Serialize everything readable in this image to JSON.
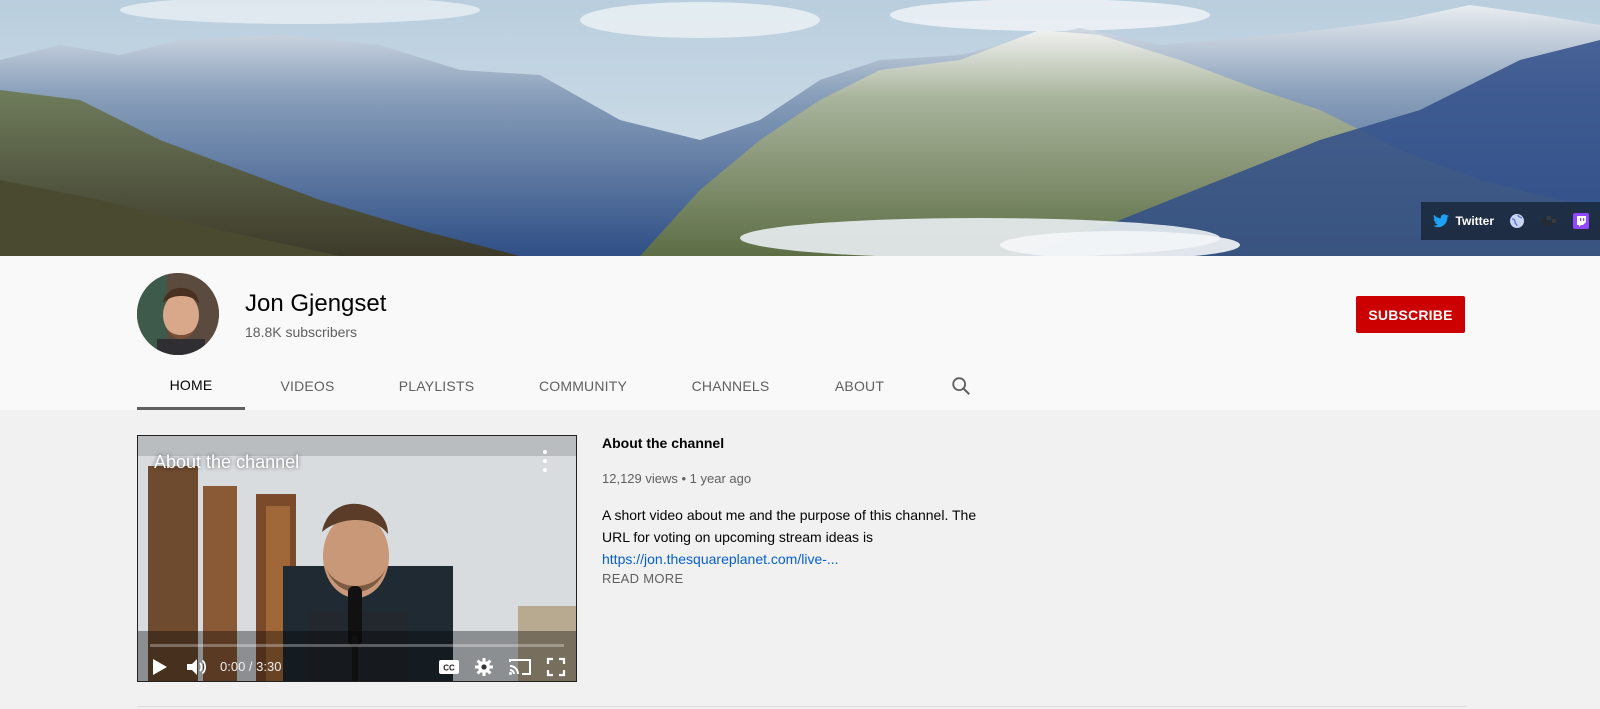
{
  "banner": {
    "links": {
      "twitter_label": "Twitter",
      "icons": [
        "twitter-icon",
        "globe-icon",
        "link-icon",
        "twitch-icon"
      ]
    }
  },
  "channel": {
    "name": "Jon Gjengset",
    "subscribers": "18.8K subscribers",
    "subscribe_label": "SUBSCRIBE"
  },
  "tabs": [
    {
      "label": "HOME",
      "active": true
    },
    {
      "label": "VIDEOS"
    },
    {
      "label": "PLAYLISTS"
    },
    {
      "label": "COMMUNITY"
    },
    {
      "label": "CHANNELS"
    },
    {
      "label": "ABOUT"
    }
  ],
  "featured": {
    "player_title": "About the channel",
    "time": "0:00 / 3:30",
    "title": "About the channel",
    "meta": "12,129 views • 1 year ago",
    "description": "A short video about me and the purpose of this channel. The URL for voting on upcoming stream ideas is",
    "link": "https://jon.thesquareplanet.com/live-...",
    "read_more": "READ MORE"
  },
  "colors": {
    "subscribe": "#cc0000",
    "link": "#065fd4",
    "twitch": "#9146ff",
    "twitter": "#1da1f2"
  }
}
